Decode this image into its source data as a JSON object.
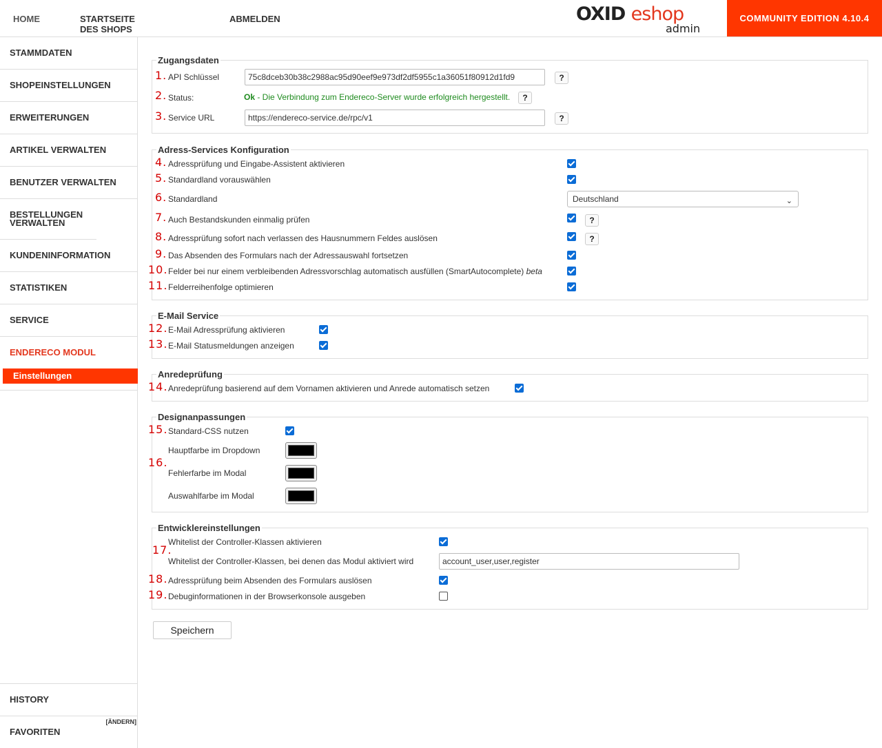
{
  "top_nav": {
    "home": "HOME",
    "shop": "STARTSEITE DES SHOPS",
    "logout": "ABMELDEN"
  },
  "logo": {
    "brand_a": "OXID",
    "brand_b": "eshop",
    "sub": "admin"
  },
  "edition": "COMMUNITY EDITION 4.10.4",
  "sidebar": {
    "items": [
      "STAMMDATEN",
      "SHOPEINSTELLUNGEN",
      "ERWEITERUNGEN",
      "ARTIKEL VERWALTEN",
      "BENUTZER VERWALTEN",
      "BESTELLUNGEN VERWALTEN",
      "KUNDENINFORMATION",
      "STATISTIKEN",
      "SERVICE",
      "ENDERECO MODUL"
    ],
    "active_sub": "Einstellungen",
    "history": "HISTORY",
    "favorites": "FAVORITEN",
    "change": "[ändern]"
  },
  "sections": {
    "access": {
      "title": "Zugangsdaten",
      "api_label": "API Schlüssel",
      "api_value": "75c8dceb30b38c2988ac95d90eef9e973df2df5955c1a36051f80912d1fd9",
      "status_label": "Status:",
      "status_ok": "Ok",
      "status_msg": " - Die Verbindung zum Endereco-Server wurde erfolgreich hergestellt.",
      "url_label": "Service URL",
      "url_value": "https://endereco-service.de/rpc/v1"
    },
    "address": {
      "title": "Adress-Services Konfiguration",
      "r4": "Adressprüfung und Eingabe-Assistent aktivieren",
      "r5": "Standardland vorauswählen",
      "r6": "Standardland",
      "country": "Deutschland",
      "r7": "Auch Bestandskunden einmalig prüfen",
      "r8": "Adressprüfung sofort nach verlassen des Hausnummern Feldes auslösen",
      "r9": "Das Absenden des Formulars nach der Adressauswahl fortsetzen",
      "r10": "Felder bei nur einem verbleibenden Adressvorschlag automatisch ausfüllen (SmartAutocomplete)",
      "r10_beta": "beta",
      "r11": "Felderreihenfolge optimieren"
    },
    "email": {
      "title": "E-Mail Service",
      "r12": "E-Mail Adressprüfung aktivieren",
      "r13": "E-Mail Statusmeldungen anzeigen"
    },
    "salutation": {
      "title": "Anredeprüfung",
      "r14": "Anredeprüfung basierend auf dem Vornamen aktivieren und Anrede automatisch setzen"
    },
    "design": {
      "title": "Designanpassungen",
      "r15": "Standard-CSS nutzen",
      "c1": "Hauptfarbe im Dropdown",
      "c2": "Fehlerfarbe im Modal",
      "c3": "Auswahlfarbe im Modal",
      "swatch_color": "#000000"
    },
    "dev": {
      "title": "Entwicklereinstellungen",
      "r17a": "Whitelist der Controller-Klassen aktivieren",
      "r17b": "Whitelist der Controller-Klassen, bei denen das Modul aktiviert wird",
      "whitelist": "account_user,user,register",
      "r18": "Adressprüfung beim Absenden des Formulars auslösen",
      "r19": "Debuginformationen in der Browserkonsole ausgeben"
    }
  },
  "numbers": [
    "1.",
    "2.",
    "3.",
    "4.",
    "5.",
    "6.",
    "7.",
    "8.",
    "9.",
    "10.",
    "11.",
    "12.",
    "13.",
    "14.",
    "15.",
    "16.",
    "17.",
    "18.",
    "19."
  ],
  "help_glyph": "?",
  "checkbox_states": {
    "r4": true,
    "r5": true,
    "r7": true,
    "r8": true,
    "r9": true,
    "r10": true,
    "r11": true,
    "r12": true,
    "r13": true,
    "r14": true,
    "r15": true,
    "r17a": true,
    "r18": true,
    "r19": false
  },
  "save_label": "Speichern"
}
